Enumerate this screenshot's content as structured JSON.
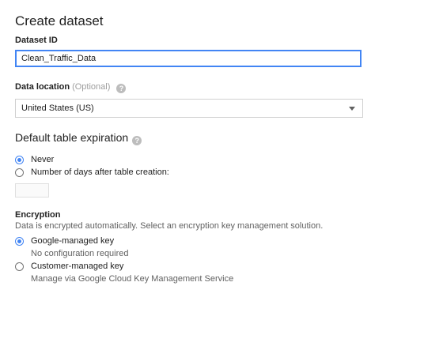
{
  "page_title": "Create dataset",
  "dataset_id": {
    "label": "Dataset ID",
    "value": "Clean_Traffic_Data"
  },
  "data_location": {
    "label": "Data location",
    "optional_hint": "(Optional)",
    "help_icon": "help-icon",
    "selected": "United States (US)"
  },
  "table_expiration": {
    "title": "Default table expiration",
    "help_icon": "help-icon",
    "options": [
      {
        "label": "Never",
        "checked": true
      },
      {
        "label": "Number of days after table creation:",
        "checked": false
      }
    ],
    "days_value": ""
  },
  "encryption": {
    "title": "Encryption",
    "description": "Data is encrypted automatically. Select an encryption key management solution.",
    "options": [
      {
        "label": "Google-managed key",
        "sublabel": "No configuration required",
        "checked": true
      },
      {
        "label": "Customer-managed key",
        "sublabel": "Manage via Google Cloud Key Management Service",
        "checked": false
      }
    ]
  },
  "colors": {
    "accent": "#4285f4",
    "text": "#212121",
    "secondary_text": "#616161"
  }
}
